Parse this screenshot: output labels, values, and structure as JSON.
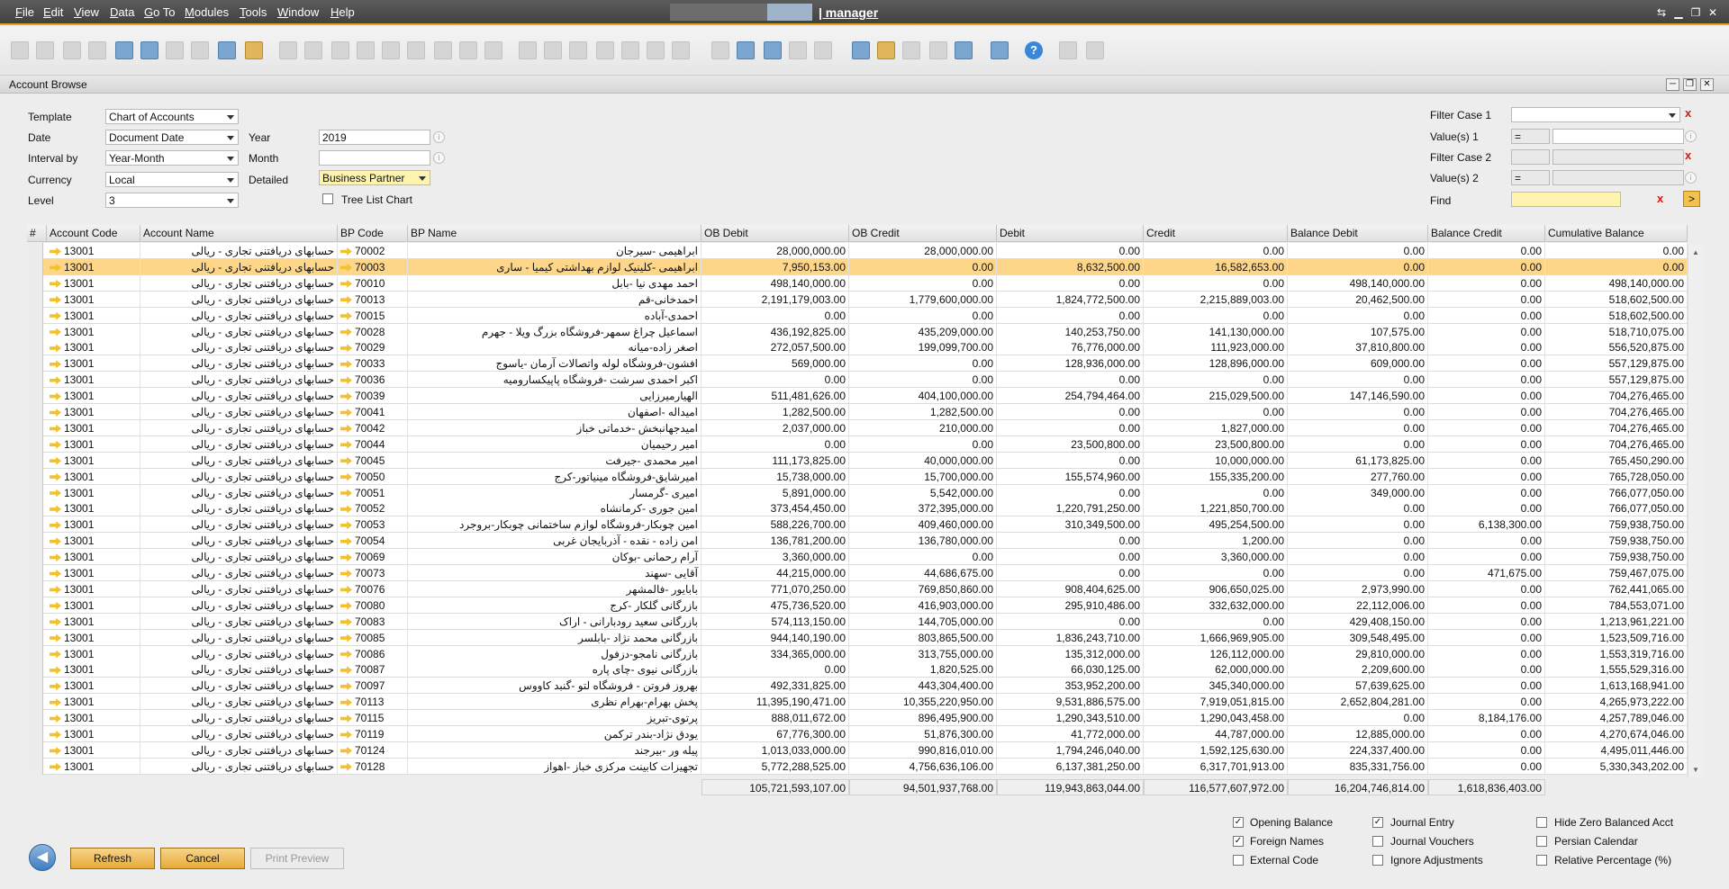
{
  "menu": [
    "File",
    "Edit",
    "View",
    "Data",
    "Go To",
    "Modules",
    "Tools",
    "Window",
    "Help"
  ],
  "app_title": "| manager",
  "window_title": "Account Browse",
  "form": {
    "template_label": "Template",
    "template_value": "Chart of Accounts",
    "date_label": "Date",
    "date_value": "Document Date",
    "interval_label": "Interval by",
    "interval_value": "Year-Month",
    "currency_label": "Currency",
    "currency_value": "Local",
    "level_label": "Level",
    "level_value": "3",
    "year_label": "Year",
    "year_value": "2019",
    "month_label": "Month",
    "month_value": "",
    "detailed_label": "Detailed",
    "detailed_value": "Business Partner",
    "tree_label": "Tree List Chart",
    "filter1_label": "Filter Case 1",
    "values1_label": "Value(s) 1",
    "values1_op": "=",
    "filter2_label": "Filter Case 2",
    "values2_label": "Value(s) 2",
    "values2_op": "=",
    "find_label": "Find"
  },
  "columns": [
    "#",
    "Account Code",
    "Account Name",
    "BP Code",
    "BP Name",
    "OB Debit",
    "OB Credit",
    "Debit",
    "Credit",
    "Balance Debit",
    "Balance Credit",
    "Cumulative Balance"
  ],
  "account_name": "حسابهای دریافتنی تجاری - ریالی",
  "rows": [
    [
      "13001",
      "70002",
      "ابراهیمی -سیرجان",
      "28,000,000.00",
      "28,000,000.00",
      "0.00",
      "0.00",
      "0.00",
      "0.00",
      "0.00"
    ],
    [
      "13001",
      "70003",
      "ابراهیمی -کلینیک لوازم بهداشتی کیمیا - ساری",
      "7,950,153.00",
      "0.00",
      "8,632,500.00",
      "16,582,653.00",
      "0.00",
      "0.00",
      "0.00"
    ],
    [
      "13001",
      "70010",
      "احمد مهدی نیا -بابل",
      "498,140,000.00",
      "0.00",
      "0.00",
      "0.00",
      "498,140,000.00",
      "0.00",
      "498,140,000.00"
    ],
    [
      "13001",
      "70013",
      "احمدخانی-قم",
      "2,191,179,003.00",
      "1,779,600,000.00",
      "1,824,772,500.00",
      "2,215,889,003.00",
      "20,462,500.00",
      "0.00",
      "518,602,500.00"
    ],
    [
      "13001",
      "70015",
      "احمدی-آباده",
      "0.00",
      "0.00",
      "0.00",
      "0.00",
      "0.00",
      "0.00",
      "518,602,500.00"
    ],
    [
      "13001",
      "70028",
      "اسماعیل چراغ سمهر-فروشگاه بزرگ ویلا - جهرم",
      "436,192,825.00",
      "435,209,000.00",
      "140,253,750.00",
      "141,130,000.00",
      "107,575.00",
      "0.00",
      "518,710,075.00"
    ],
    [
      "13001",
      "70029",
      "اصغر زاده-میانه",
      "272,057,500.00",
      "199,099,700.00",
      "76,776,000.00",
      "111,923,000.00",
      "37,810,800.00",
      "0.00",
      "556,520,875.00"
    ],
    [
      "13001",
      "70033",
      "افشون-فروشگاه لوله واتصالات آرمان -یاسوج",
      "569,000.00",
      "0.00",
      "128,936,000.00",
      "128,896,000.00",
      "609,000.00",
      "0.00",
      "557,129,875.00"
    ],
    [
      "13001",
      "70036",
      "اکبر احمدی سرشت -فروشگاه پاپیکساروميه",
      "0.00",
      "0.00",
      "0.00",
      "0.00",
      "0.00",
      "0.00",
      "557,129,875.00"
    ],
    [
      "13001",
      "70039",
      "الهیارمیرزایی",
      "511,481,626.00",
      "404,100,000.00",
      "254,794,464.00",
      "215,029,500.00",
      "147,146,590.00",
      "0.00",
      "704,276,465.00"
    ],
    [
      "13001",
      "70041",
      "امیداله -اصفهان",
      "1,282,500.00",
      "1,282,500.00",
      "0.00",
      "0.00",
      "0.00",
      "0.00",
      "704,276,465.00"
    ],
    [
      "13001",
      "70042",
      "امیدجهانبخش -خدماتی خباز",
      "2,037,000.00",
      "210,000.00",
      "0.00",
      "1,827,000.00",
      "0.00",
      "0.00",
      "704,276,465.00"
    ],
    [
      "13001",
      "70044",
      "امیر رحیمیان",
      "0.00",
      "0.00",
      "23,500,800.00",
      "23,500,800.00",
      "0.00",
      "0.00",
      "704,276,465.00"
    ],
    [
      "13001",
      "70045",
      "امیر محمدی -جیرفت",
      "111,173,825.00",
      "40,000,000.00",
      "0.00",
      "10,000,000.00",
      "61,173,825.00",
      "0.00",
      "765,450,290.00"
    ],
    [
      "13001",
      "70050",
      "امیرشایق-فروشگاه مینیاتور-کرج",
      "15,738,000.00",
      "15,700,000.00",
      "155,574,960.00",
      "155,335,200.00",
      "277,760.00",
      "0.00",
      "765,728,050.00"
    ],
    [
      "13001",
      "70051",
      "امیری -گرمسار",
      "5,891,000.00",
      "5,542,000.00",
      "0.00",
      "0.00",
      "349,000.00",
      "0.00",
      "766,077,050.00"
    ],
    [
      "13001",
      "70052",
      "امین جوری -کرمانشاه",
      "373,454,450.00",
      "372,395,000.00",
      "1,220,791,250.00",
      "1,221,850,700.00",
      "0.00",
      "0.00",
      "766,077,050.00"
    ],
    [
      "13001",
      "70053",
      "امین چوبکار-فروشگاه لوازم ساختمانی چوبکار-بروجرد",
      "588,226,700.00",
      "409,460,000.00",
      "310,349,500.00",
      "495,254,500.00",
      "0.00",
      "6,138,300.00",
      "759,938,750.00"
    ],
    [
      "13001",
      "70054",
      "امن زاده - نقده - آذربایجان غربی",
      "136,781,200.00",
      "136,780,000.00",
      "0.00",
      "1,200.00",
      "0.00",
      "0.00",
      "759,938,750.00"
    ],
    [
      "13001",
      "70069",
      "آرام رحمانی -بوکان",
      "3,360,000.00",
      "0.00",
      "0.00",
      "3,360,000.00",
      "0.00",
      "0.00",
      "759,938,750.00"
    ],
    [
      "13001",
      "70073",
      "آقایی -سهند",
      "44,215,000.00",
      "44,686,675.00",
      "0.00",
      "0.00",
      "0.00",
      "471,675.00",
      "759,467,075.00"
    ],
    [
      "13001",
      "70076",
      "بابایور -فالمشهر",
      "771,070,250.00",
      "769,850,860.00",
      "908,404,625.00",
      "906,650,025.00",
      "2,973,990.00",
      "0.00",
      "762,441,065.00"
    ],
    [
      "13001",
      "70080",
      "بازرگانی گلکار -کرج",
      "475,736,520.00",
      "416,903,000.00",
      "295,910,486.00",
      "332,632,000.00",
      "22,112,006.00",
      "0.00",
      "784,553,071.00"
    ],
    [
      "13001",
      "70083",
      "بازرگانی سعید رودبارانی - اراک",
      "574,113,150.00",
      "144,705,000.00",
      "0.00",
      "0.00",
      "429,408,150.00",
      "0.00",
      "1,213,961,221.00"
    ],
    [
      "13001",
      "70085",
      "بازرگانی محمد نژاد -بابلسر",
      "944,140,190.00",
      "803,865,500.00",
      "1,836,243,710.00",
      "1,666,969,905.00",
      "309,548,495.00",
      "0.00",
      "1,523,509,716.00"
    ],
    [
      "13001",
      "70086",
      "بازرگانی نامجو-دزفول",
      "334,365,000.00",
      "313,755,000.00",
      "135,312,000.00",
      "126,112,000.00",
      "29,810,000.00",
      "0.00",
      "1,553,319,716.00"
    ],
    [
      "13001",
      "70087",
      "بازرگانی نیوی -چای پاره",
      "0.00",
      "1,820,525.00",
      "66,030,125.00",
      "62,000,000.00",
      "2,209,600.00",
      "0.00",
      "1,555,529,316.00"
    ],
    [
      "13001",
      "70097",
      "بهروز فروتن - فروشگاه لتو -گنبد کاووس",
      "492,331,825.00",
      "443,304,400.00",
      "353,952,200.00",
      "345,340,000.00",
      "57,639,625.00",
      "0.00",
      "1,613,168,941.00"
    ],
    [
      "13001",
      "70113",
      "پخش بهرام-بهرام نظری",
      "11,395,190,471.00",
      "10,355,220,950.00",
      "9,531,886,575.00",
      "7,919,051,815.00",
      "2,652,804,281.00",
      "0.00",
      "4,265,973,222.00"
    ],
    [
      "13001",
      "70115",
      "پرتوی-تبریز",
      "888,011,672.00",
      "896,495,900.00",
      "1,290,343,510.00",
      "1,290,043,458.00",
      "0.00",
      "8,184,176.00",
      "4,257,789,046.00"
    ],
    [
      "13001",
      "70119",
      "یودق نژاد-بندر ترکمن",
      "67,776,300.00",
      "51,876,300.00",
      "41,772,000.00",
      "44,787,000.00",
      "12,885,000.00",
      "0.00",
      "4,270,674,046.00"
    ],
    [
      "13001",
      "70124",
      "پیله ور -بیرجند",
      "1,013,033,000.00",
      "990,816,010.00",
      "1,794,246,040.00",
      "1,592,125,630.00",
      "224,337,400.00",
      "0.00",
      "4,495,011,446.00"
    ],
    [
      "13001",
      "70128",
      "تجهیزات کابینت مرکزی خباز -اهواز",
      "5,772,288,525.00",
      "4,756,636,106.00",
      "6,137,381,250.00",
      "6,317,701,913.00",
      "835,331,756.00",
      "0.00",
      "5,330,343,202.00"
    ]
  ],
  "totals": [
    "105,721,593,107.00",
    "94,501,937,768.00",
    "119,943,863,044.00",
    "116,577,607,972.00",
    "16,204,746,814.00",
    "1,618,836,403.00"
  ],
  "buttons": {
    "refresh": "Refresh",
    "cancel": "Cancel",
    "print_preview": "Print Preview"
  },
  "options": {
    "opening_balance": "Opening Balance",
    "foreign_names": "Foreign Names",
    "external_code": "External Code",
    "journal_entry": "Journal Entry",
    "journal_vouchers": "Journal Vouchers",
    "ignore_adjustments": "Ignore Adjustments",
    "hide_zero": "Hide Zero Balanced Acct",
    "persian_calendar": "Persian Calendar",
    "relative_percentage": "Relative Percentage (%)"
  }
}
